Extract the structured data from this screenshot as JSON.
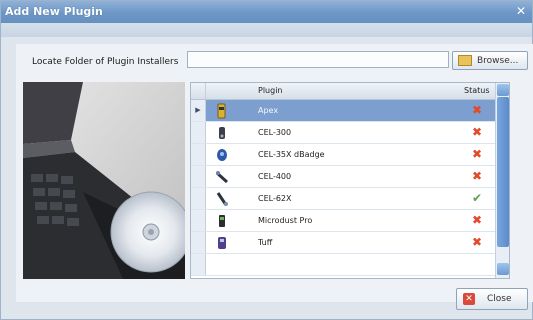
{
  "window": {
    "title": "Add New Plugin",
    "close_glyph": "✕"
  },
  "locate": {
    "label": "Locate Folder of Plugin Installers",
    "value": "",
    "browse_label": "Browse..."
  },
  "grid": {
    "headers": {
      "plugin": "Plugin",
      "status": "Status"
    },
    "rows": [
      {
        "name": "Apex",
        "status": "error",
        "icon": "usb-stick-icon",
        "selected": true
      },
      {
        "name": "CEL-300",
        "status": "error",
        "icon": "handheld-device-icon",
        "selected": false
      },
      {
        "name": "CEL-35X dBadge",
        "status": "error",
        "icon": "badge-device-icon",
        "selected": false
      },
      {
        "name": "CEL-400",
        "status": "error",
        "icon": "probe-device-icon",
        "selected": false
      },
      {
        "name": "CEL-62X",
        "status": "ok",
        "icon": "probe-device-icon",
        "selected": false
      },
      {
        "name": "Microdust Pro",
        "status": "error",
        "icon": "dust-meter-icon",
        "selected": false
      },
      {
        "name": "Tuff",
        "status": "error",
        "icon": "tuff-device-icon",
        "selected": false
      }
    ],
    "status_glyphs": {
      "error": "✖",
      "ok": "✔"
    },
    "selector_glyph": "▶"
  },
  "footer": {
    "close_label": "Close",
    "close_icon_glyph": "✕"
  },
  "colors": {
    "title_bar": "#6d97c6",
    "selected_row": "#7d9fd0",
    "status_error": "#e24a2a",
    "status_ok": "#59a34a"
  }
}
